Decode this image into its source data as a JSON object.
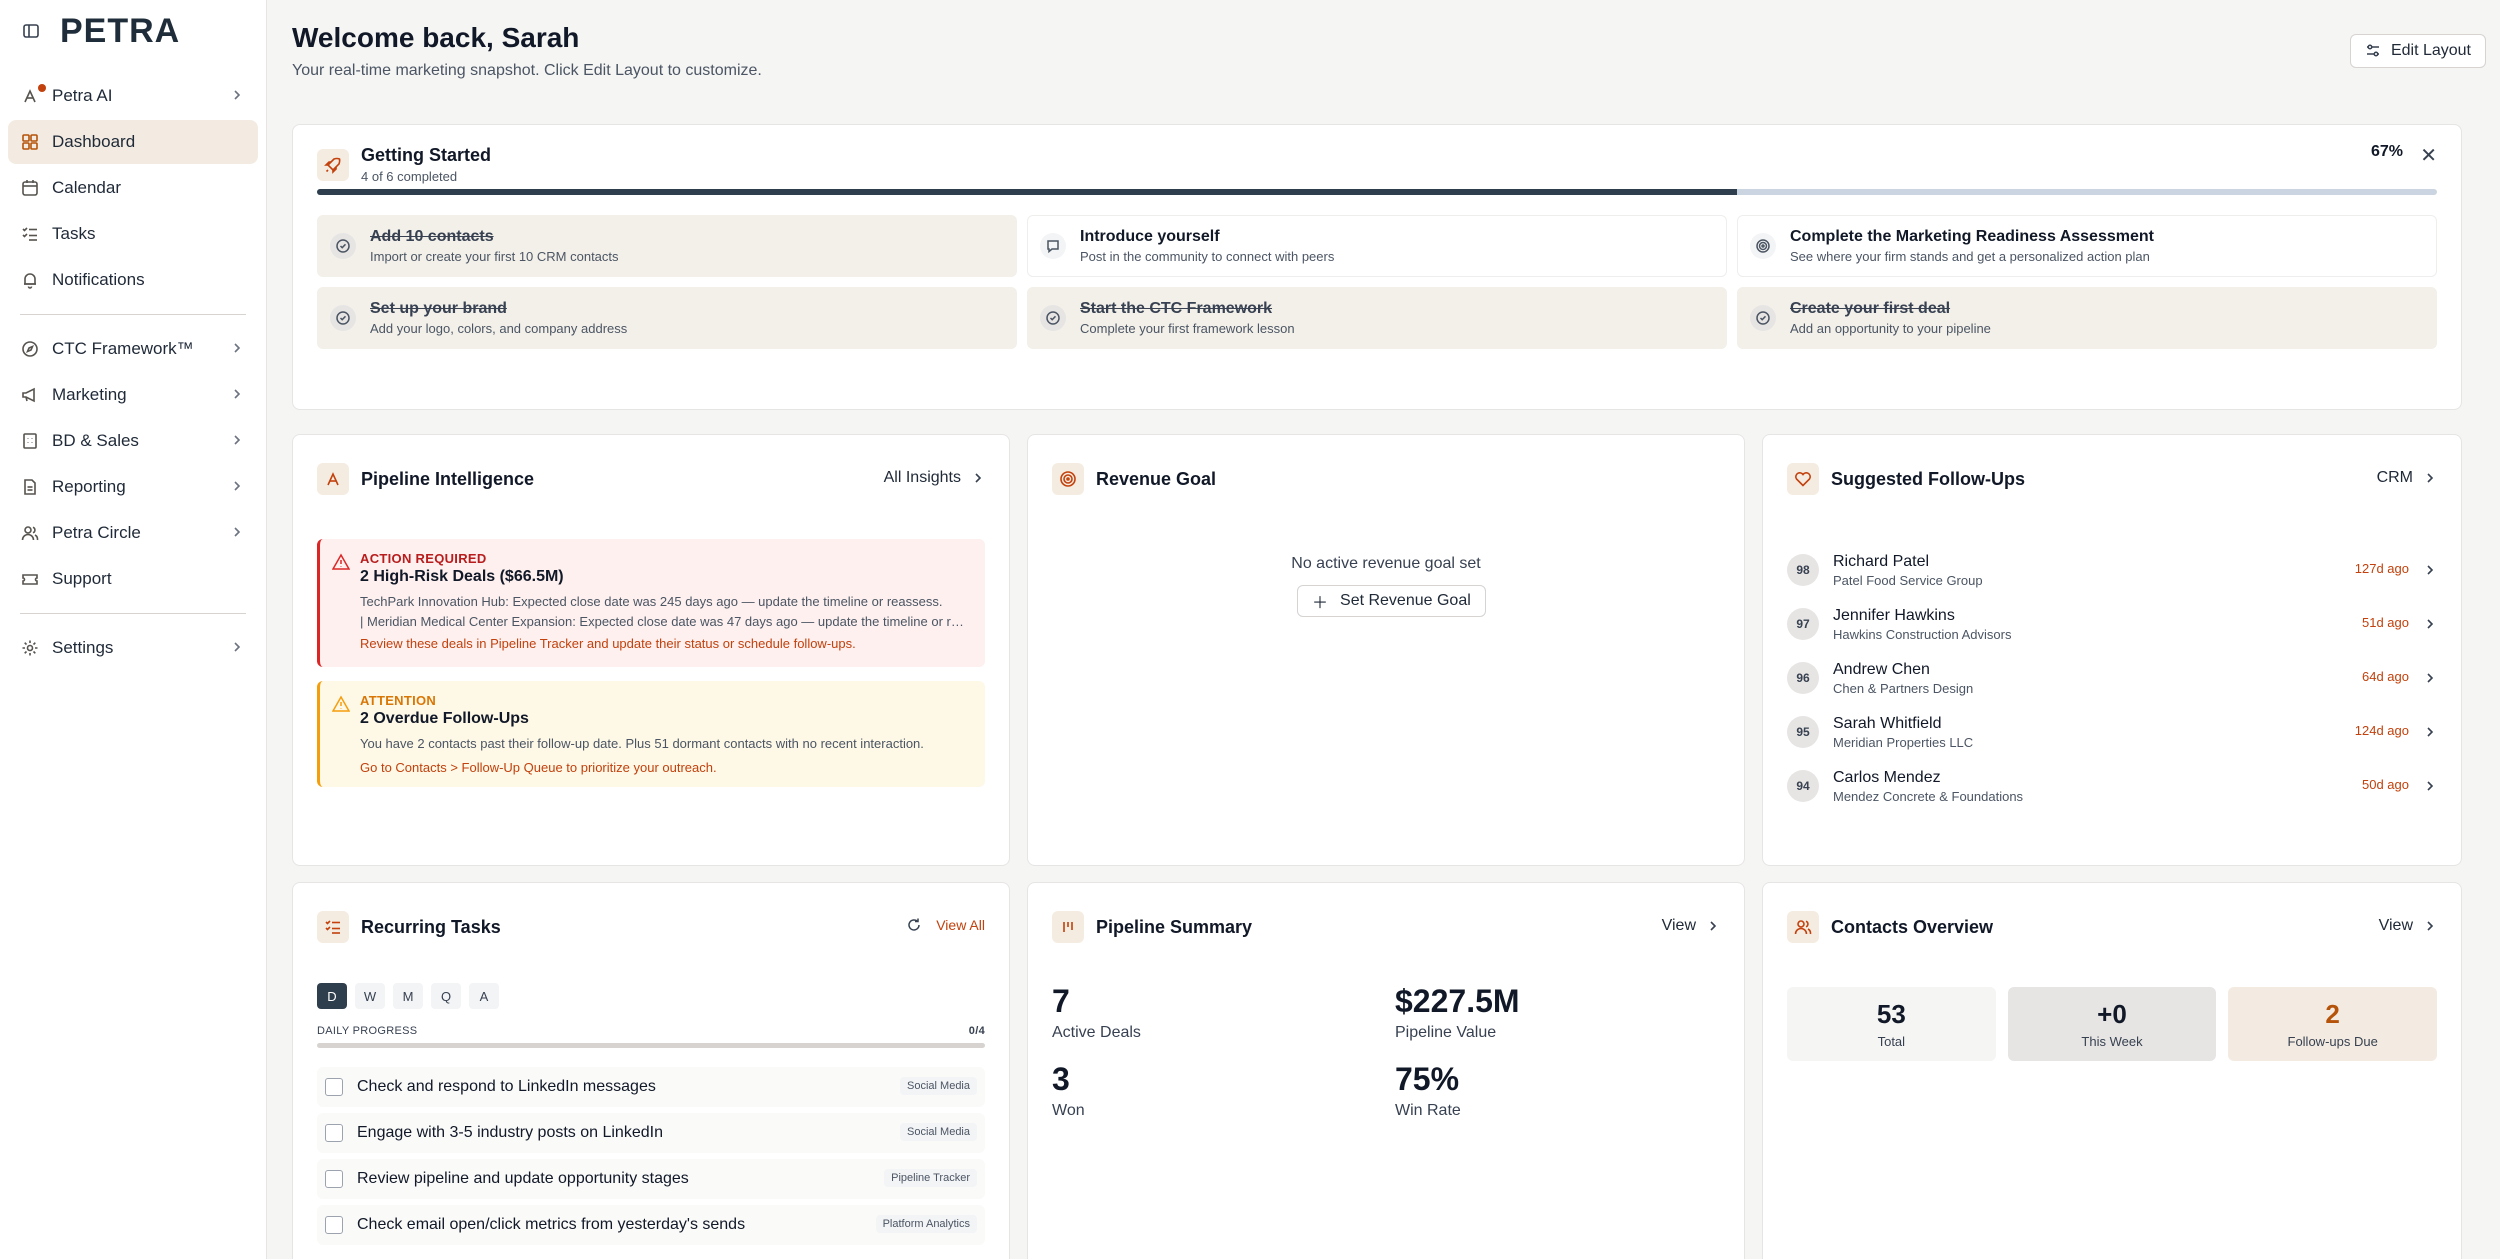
{
  "sidebar": {
    "logo": "PETRA",
    "items": [
      {
        "label": "Petra AI"
      },
      {
        "label": "Dashboard"
      },
      {
        "label": "Calendar"
      },
      {
        "label": "Tasks"
      },
      {
        "label": "Notifications"
      },
      {
        "label": "CTC Framework™"
      },
      {
        "label": "Marketing"
      },
      {
        "label": "BD & Sales"
      },
      {
        "label": "Reporting"
      },
      {
        "label": "Petra Circle"
      },
      {
        "label": "Support"
      },
      {
        "label": "Settings"
      }
    ]
  },
  "header": {
    "title": "Welcome back, Sarah",
    "subtitle": "Your real-time marketing snapshot. Click Edit Layout to customize.",
    "edit_label": "Edit Layout"
  },
  "getting_started": {
    "title": "Getting Started",
    "subtitle": "4 of 6 completed",
    "percent_label": "67%",
    "progress": 0.67,
    "items": [
      {
        "title": "Add 10 contacts",
        "desc": "Import or create your first 10 CRM contacts",
        "done": true
      },
      {
        "title": "Introduce yourself",
        "desc": "Post in the community to connect with peers",
        "done": false
      },
      {
        "title": "Complete the Marketing Readiness Assessment",
        "desc": "See where your firm stands and get a personalized action plan",
        "done": false
      },
      {
        "title": "Set up your brand",
        "desc": "Add your logo, colors, and company address",
        "done": true
      },
      {
        "title": "Start the CTC Framework",
        "desc": "Complete your first framework lesson",
        "done": true
      },
      {
        "title": "Create your first deal",
        "desc": "Add an opportunity to your pipeline",
        "done": true
      }
    ]
  },
  "pipeline_intel": {
    "title": "Pipeline Intelligence",
    "link": "All Insights",
    "alerts": [
      {
        "label": "ACTION REQUIRED",
        "heading": "2 High-Risk Deals ($66.5M)",
        "line1": "TechPark Innovation Hub: Expected close date was 245 days ago — update the timeline or reassess.",
        "line2": "| Meridian Medical Center Expansion: Expected close date was 47 days ago — update the timeline or reassess.",
        "action": "Review these deals in Pipeline Tracker and update their status or schedule follow-ups."
      },
      {
        "label": "ATTENTION",
        "heading": "2 Overdue Follow-Ups",
        "line1": "You have 2 contacts past their follow-up date. Plus 51 dormant contacts with no recent interaction.",
        "action": "Go to Contacts > Follow-Up Queue to prioritize your outreach."
      }
    ]
  },
  "revenue_goal": {
    "title": "Revenue Goal",
    "empty": "No active revenue goal set",
    "button": "Set Revenue Goal"
  },
  "followups": {
    "title": "Suggested Follow-Ups",
    "link": "CRM",
    "items": [
      {
        "score": "98",
        "name": "Richard Patel",
        "company": "Patel Food Service Group",
        "ago": "127d ago"
      },
      {
        "score": "97",
        "name": "Jennifer Hawkins",
        "company": "Hawkins Construction Advisors",
        "ago": "51d ago"
      },
      {
        "score": "96",
        "name": "Andrew Chen",
        "company": "Chen & Partners Design",
        "ago": "64d ago"
      },
      {
        "score": "95",
        "name": "Sarah Whitfield",
        "company": "Meridian Properties LLC",
        "ago": "124d ago"
      },
      {
        "score": "94",
        "name": "Carlos Mendez",
        "company": "Mendez Concrete & Foundations",
        "ago": "50d ago"
      }
    ]
  },
  "recurring": {
    "title": "Recurring Tasks",
    "view_all": "View All",
    "freq": [
      "D",
      "W",
      "M",
      "Q",
      "A"
    ],
    "progress_label": "DAILY PROGRESS",
    "progress_value": "0/4",
    "tasks": [
      {
        "title": "Check and respond to LinkedIn messages",
        "tag": "Social Media"
      },
      {
        "title": "Engage with 3-5 industry posts on LinkedIn",
        "tag": "Social Media"
      },
      {
        "title": "Review pipeline and update opportunity stages",
        "tag": "Pipeline Tracker"
      },
      {
        "title": "Check email open/click metrics from yesterday's sends",
        "tag": "Platform Analytics"
      }
    ]
  },
  "pipeline_summary": {
    "title": "Pipeline Summary",
    "link": "View",
    "stats": [
      {
        "value": "7",
        "label": "Active Deals"
      },
      {
        "value": "$227.5M",
        "label": "Pipeline Value"
      },
      {
        "value": "3",
        "label": "Won"
      },
      {
        "value": "75%",
        "label": "Win Rate"
      }
    ]
  },
  "contacts": {
    "title": "Contacts Overview",
    "link": "View",
    "stats": [
      {
        "value": "53",
        "label": "Total"
      },
      {
        "value": "+0",
        "label": "This Week"
      },
      {
        "value": "2",
        "label": "Follow-ups Due"
      }
    ]
  }
}
